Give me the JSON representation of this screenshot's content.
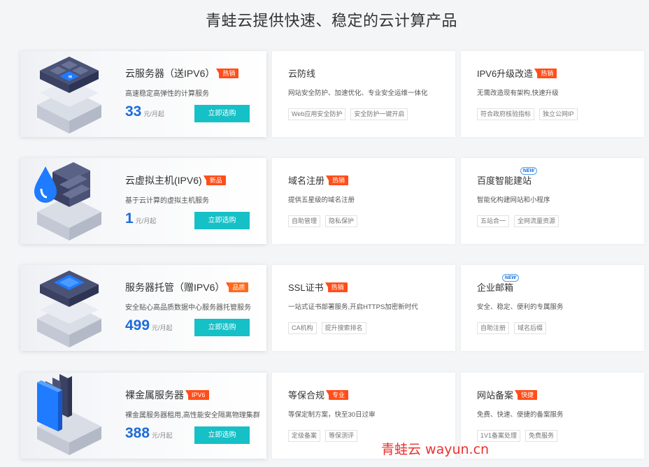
{
  "page": {
    "title": "青蛙云提供快速、稳定的云计算产品"
  },
  "products": [
    {
      "main": {
        "title": "云服务器（送IPV6）",
        "badge": "热销",
        "desc": "高速稳定高弹性的计算服务",
        "price": "33",
        "unit": "元/月起",
        "button": "立即选购"
      },
      "mid": {
        "title": "云防线",
        "desc": "网站安全防护、加速优化、专业安全运维一体化",
        "tags": [
          "Web应用安全防护",
          "安全防护一键开启"
        ]
      },
      "right": {
        "title": "IPV6升级改造",
        "badge": "热销",
        "desc": "无需改造现有架构,快速升级",
        "tags": [
          "符合政府核验指标",
          "独立公网IP"
        ]
      }
    },
    {
      "main": {
        "title": "云虚拟主机(IPV6)",
        "badge": "新品",
        "desc": "基于云计算的虚拟主机服务",
        "price": "1",
        "unit": "元/月起",
        "button": "立即选购"
      },
      "mid": {
        "title": "域名注册",
        "badge": "热销",
        "desc": "提供五星级的域名注册",
        "tags": [
          "自助管理",
          "隐私保护"
        ]
      },
      "right": {
        "title": "百度智能建站",
        "new": "NEW",
        "desc": "智能化构建网站和小程序",
        "tags": [
          "五站合一",
          "全网流量资源"
        ]
      }
    },
    {
      "main": {
        "title": "服务器托管（赠IPV6）",
        "badge": "品质",
        "desc": "安全贴心高品质数据中心服务器托管服务",
        "price": "499",
        "unit": "元/月起",
        "button": "立即选购"
      },
      "mid": {
        "title": "SSL证书",
        "badge": "热销",
        "desc": "一站式证书部署服务,开启HTTPS加密新时代",
        "tags": [
          "CA机构",
          "提升搜索排名"
        ]
      },
      "right": {
        "title": "企业邮箱",
        "new": "NEW",
        "desc": "安全、稳定、便利的专属服务",
        "tags": [
          "自助注册",
          "域名后缀"
        ]
      }
    },
    {
      "main": {
        "title": "裸金属服务器",
        "badge": "IPV6",
        "desc": "裸金属服务器租用,高性能安全隔离物理集群",
        "price": "388",
        "unit": "元/月起",
        "button": "立即选购"
      },
      "mid": {
        "title": "等保合规",
        "badge": "专业",
        "desc": "等保定制方案，快至30日过审",
        "tags": [
          "定级备案",
          "等保测评"
        ]
      },
      "right": {
        "title": "网站备案",
        "badge": "快捷",
        "desc": "免费、快速、便捷的备案服务",
        "tags": [
          "1V1备案处理",
          "免费服务"
        ]
      }
    }
  ],
  "watermark": "青蛙云 wayun.cn",
  "colors": {
    "accent": "#1d6bdc",
    "button": "#16c0c7",
    "badge": "#ff4e1a",
    "watermark": "#e9322d"
  },
  "icons": [
    "server-calculator-icon",
    "server-drop-icon",
    "server-chip-icon",
    "server-rack-icon"
  ]
}
